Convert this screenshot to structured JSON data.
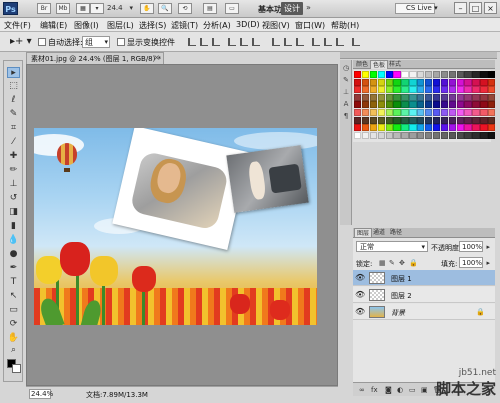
{
  "titlebar": {
    "logo": "Ps",
    "zoom": "24.4",
    "workspace_label": "基本功能",
    "workspace_active": "设计",
    "cslive": "CS Live ▾"
  },
  "menu": [
    "文件(F)",
    "编辑(E)",
    "图像(I)",
    "图层(L)",
    "选择(S)",
    "滤镜(T)",
    "分析(A)",
    "3D(D)",
    "视图(V)",
    "窗口(W)",
    "帮助(H)"
  ],
  "options": {
    "auto_select_label": "自动选择:",
    "auto_select_value": "组",
    "show_transform_label": "显示变换控件"
  },
  "document": {
    "tab_title": "素材01.jpg @ 24.4% (图层 1, RGB/8) *",
    "close": "×",
    "zoom": "24.4%",
    "doc_info": "文档:7.89M/13.3M"
  },
  "panels": {
    "swatch_tabs": [
      "颜色",
      "色板",
      "样式"
    ],
    "layer_tabs": [
      "图层",
      "通道",
      "路径"
    ],
    "blend_mode": "正常",
    "opacity_label": "不透明度:",
    "opacity": "100%",
    "lock_label": "锁定:",
    "fill_label": "填充:",
    "fill": "100%",
    "layers": [
      {
        "name": "图层 1",
        "active": true,
        "background": false
      },
      {
        "name": "图层 2",
        "active": false,
        "background": false
      },
      {
        "name": "背景",
        "active": false,
        "background": true
      }
    ]
  },
  "watermark": {
    "site": "jb51.net",
    "brand": "脚本之家"
  },
  "colors": {
    "accent": "#9dbde0",
    "swatches": [
      "#ff0000",
      "#ffff00",
      "#00ff00",
      "#00ffff",
      "#0000ff",
      "#ff00ff",
      "#ffffff",
      "#f2f2f2",
      "#d9d9d9",
      "#bfbfbf",
      "#a6a6a6",
      "#8c8c8c",
      "#737373",
      "#595959",
      "#404040",
      "#262626",
      "#0d0d0d",
      "#000000"
    ]
  }
}
